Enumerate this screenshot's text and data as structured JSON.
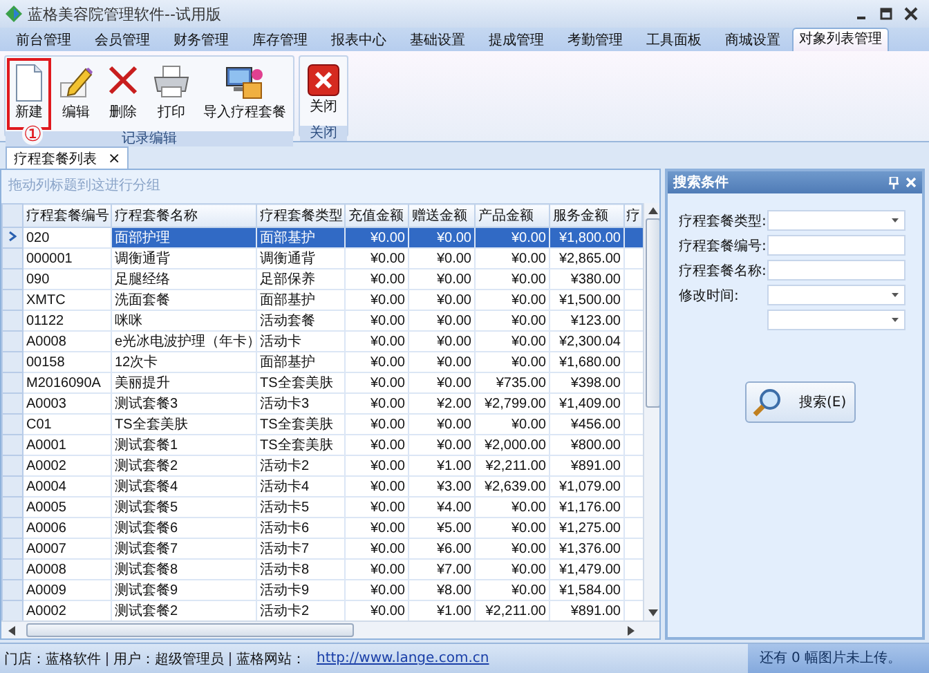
{
  "window": {
    "title": "蓝格美容院管理软件--试用版"
  },
  "menu_tabs": [
    {
      "label": "前台管理",
      "selected": false
    },
    {
      "label": "会员管理",
      "selected": false
    },
    {
      "label": "财务管理",
      "selected": false
    },
    {
      "label": "库存管理",
      "selected": false
    },
    {
      "label": "报表中心",
      "selected": false
    },
    {
      "label": "基础设置",
      "selected": false
    },
    {
      "label": "提成管理",
      "selected": false
    },
    {
      "label": "考勤管理",
      "selected": false
    },
    {
      "label": "工具面板",
      "selected": false
    },
    {
      "label": "商城设置",
      "selected": false
    },
    {
      "label": "对象列表管理",
      "selected": true
    }
  ],
  "ribbon_groups": [
    {
      "label": "记录编辑",
      "buttons": [
        {
          "label": "新建",
          "kind": "new",
          "highlighted": true
        },
        {
          "label": "编辑",
          "kind": "edit",
          "highlighted": false
        },
        {
          "label": "删除",
          "kind": "delete",
          "highlighted": false
        },
        {
          "label": "打印",
          "kind": "print",
          "highlighted": false
        },
        {
          "label": "导入疗程套餐",
          "kind": "import",
          "highlighted": false
        }
      ]
    },
    {
      "label": "关闭",
      "buttons": [
        {
          "label": "关闭",
          "kind": "close",
          "highlighted": false
        }
      ]
    }
  ],
  "annotation": "①",
  "document_tab": {
    "label": "疗程套餐列表",
    "close": "×"
  },
  "group_panel_hint": "拖动列标题到这进行分组",
  "table": {
    "columns": [
      "疗程套餐编号",
      "疗程套餐名称",
      "疗程套餐类型",
      "充值金额",
      "赠送金额",
      "产品金额",
      "服务金额",
      "疗"
    ],
    "rows": [
      {
        "selected": true,
        "cells": [
          "020",
          "面部护理",
          "面部基护",
          "¥0.00",
          "¥0.00",
          "¥0.00",
          "¥1,800.00"
        ]
      },
      {
        "selected": false,
        "cells": [
          "000001",
          "调衡通背",
          "调衡通背",
          "¥0.00",
          "¥0.00",
          "¥0.00",
          "¥2,865.00"
        ]
      },
      {
        "selected": false,
        "cells": [
          "090",
          "足腿经络",
          "足部保养",
          "¥0.00",
          "¥0.00",
          "¥0.00",
          "¥380.00"
        ]
      },
      {
        "selected": false,
        "cells": [
          "XMTC",
          "洗面套餐",
          "面部基护",
          "¥0.00",
          "¥0.00",
          "¥0.00",
          "¥1,500.00"
        ]
      },
      {
        "selected": false,
        "cells": [
          "01122",
          "咪咪",
          "活动套餐",
          "¥0.00",
          "¥0.00",
          "¥0.00",
          "¥123.00"
        ]
      },
      {
        "selected": false,
        "cells": [
          "A0008",
          "e光冰电波护理（年卡）",
          "活动卡",
          "¥0.00",
          "¥0.00",
          "¥0.00",
          "¥2,300.04"
        ]
      },
      {
        "selected": false,
        "cells": [
          "00158",
          "12次卡",
          "面部基护",
          "¥0.00",
          "¥0.00",
          "¥0.00",
          "¥1,680.00"
        ]
      },
      {
        "selected": false,
        "cells": [
          "M2016090A",
          "美丽提升",
          "TS全套美肤",
          "¥0.00",
          "¥0.00",
          "¥735.00",
          "¥398.00"
        ]
      },
      {
        "selected": false,
        "cells": [
          "A0003",
          "测试套餐3",
          "活动卡3",
          "¥0.00",
          "¥2.00",
          "¥2,799.00",
          "¥1,409.00"
        ]
      },
      {
        "selected": false,
        "cells": [
          "C01",
          "TS全套美肤",
          "TS全套美肤",
          "¥0.00",
          "¥0.00",
          "¥0.00",
          "¥456.00"
        ]
      },
      {
        "selected": false,
        "cells": [
          "A0001",
          "测试套餐1",
          "TS全套美肤",
          "¥0.00",
          "¥0.00",
          "¥2,000.00",
          "¥800.00"
        ]
      },
      {
        "selected": false,
        "cells": [
          "A0002",
          "测试套餐2",
          "活动卡2",
          "¥0.00",
          "¥1.00",
          "¥2,211.00",
          "¥891.00"
        ]
      },
      {
        "selected": false,
        "cells": [
          "A0004",
          "测试套餐4",
          "活动卡4",
          "¥0.00",
          "¥3.00",
          "¥2,639.00",
          "¥1,079.00"
        ]
      },
      {
        "selected": false,
        "cells": [
          "A0005",
          "测试套餐5",
          "活动卡5",
          "¥0.00",
          "¥4.00",
          "¥0.00",
          "¥1,176.00"
        ]
      },
      {
        "selected": false,
        "cells": [
          "A0006",
          "测试套餐6",
          "活动卡6",
          "¥0.00",
          "¥5.00",
          "¥0.00",
          "¥1,275.00"
        ]
      },
      {
        "selected": false,
        "cells": [
          "A0007",
          "测试套餐7",
          "活动卡7",
          "¥0.00",
          "¥6.00",
          "¥0.00",
          "¥1,376.00"
        ]
      },
      {
        "selected": false,
        "cells": [
          "A0008",
          "测试套餐8",
          "活动卡8",
          "¥0.00",
          "¥7.00",
          "¥0.00",
          "¥1,479.00"
        ]
      },
      {
        "selected": false,
        "cells": [
          "A0009",
          "测试套餐9",
          "活动卡9",
          "¥0.00",
          "¥8.00",
          "¥0.00",
          "¥1,584.00"
        ]
      },
      {
        "selected": false,
        "cells": [
          "A0002",
          "测试套餐2",
          "活动卡2",
          "¥0.00",
          "¥1.00",
          "¥2,211.00",
          "¥891.00"
        ]
      }
    ]
  },
  "search_panel": {
    "title": "搜索条件",
    "fields": [
      {
        "label": "疗程套餐类型:",
        "kind": "select"
      },
      {
        "label": "疗程套餐编号:",
        "kind": "text"
      },
      {
        "label": "疗程套餐名称:",
        "kind": "text"
      },
      {
        "label": "修改时间:",
        "kind": "select"
      },
      {
        "kind": "select"
      }
    ],
    "button": "搜索(E)"
  },
  "status_bar": {
    "store": "门店：蓝格软件",
    "user": "用户：超级管理员",
    "site_label": "蓝格网站：",
    "site_link": "http://www.lange.com.cn",
    "upload_note": "还有 0 幅图片未上传。"
  }
}
